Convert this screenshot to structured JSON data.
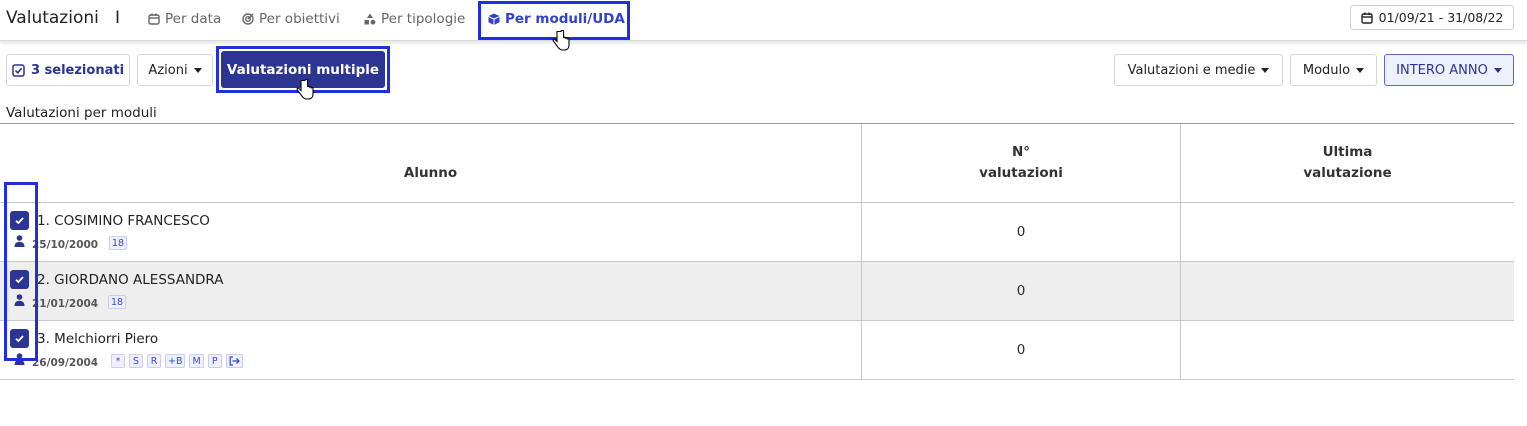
{
  "header": {
    "title": "Valutazioni",
    "title_sep": "I",
    "tabs": [
      {
        "label": "Per data",
        "icon": "calendar-icon"
      },
      {
        "label": "Per obiettivi",
        "icon": "target-icon"
      },
      {
        "label": "Per tipologie",
        "icon": "shapes-icon"
      },
      {
        "label": "Per moduli/UDA",
        "icon": "cube-icon",
        "active": true
      }
    ],
    "date_range": "01/09/21 - 31/08/22"
  },
  "toolbar": {
    "selected_label": "3 selezionati",
    "actions_label": "Azioni",
    "multiple_label": "Valutazioni multiple",
    "filter_valutazioni": "Valutazioni e medie",
    "filter_modulo": "Modulo",
    "filter_period": "INTERO ANNO"
  },
  "section": {
    "label": "Valutazioni per moduli"
  },
  "table": {
    "columns": [
      "Alunno",
      "N°\nvalutazioni",
      "Ultima\nvalutazione"
    ],
    "rows": [
      {
        "name": "1. COSIMINO FRANCESCO",
        "date": "25/10/2000",
        "badges": [
          "18"
        ],
        "count": "0",
        "last": ""
      },
      {
        "name": "2. GIORDANO ALESSANDRA",
        "date": "21/01/2004",
        "badges": [
          "18"
        ],
        "count": "0",
        "last": ""
      },
      {
        "name": "3. Melchiorri Piero",
        "date": "26/09/2004",
        "badges": [
          "*",
          "S",
          "R",
          "+B",
          "M",
          "P",
          "exit-icon"
        ],
        "count": "0",
        "last": ""
      }
    ]
  },
  "colors": {
    "accent": "#2d3593",
    "highlight": "#1f2fe0",
    "active_tab": "#3343c9"
  }
}
